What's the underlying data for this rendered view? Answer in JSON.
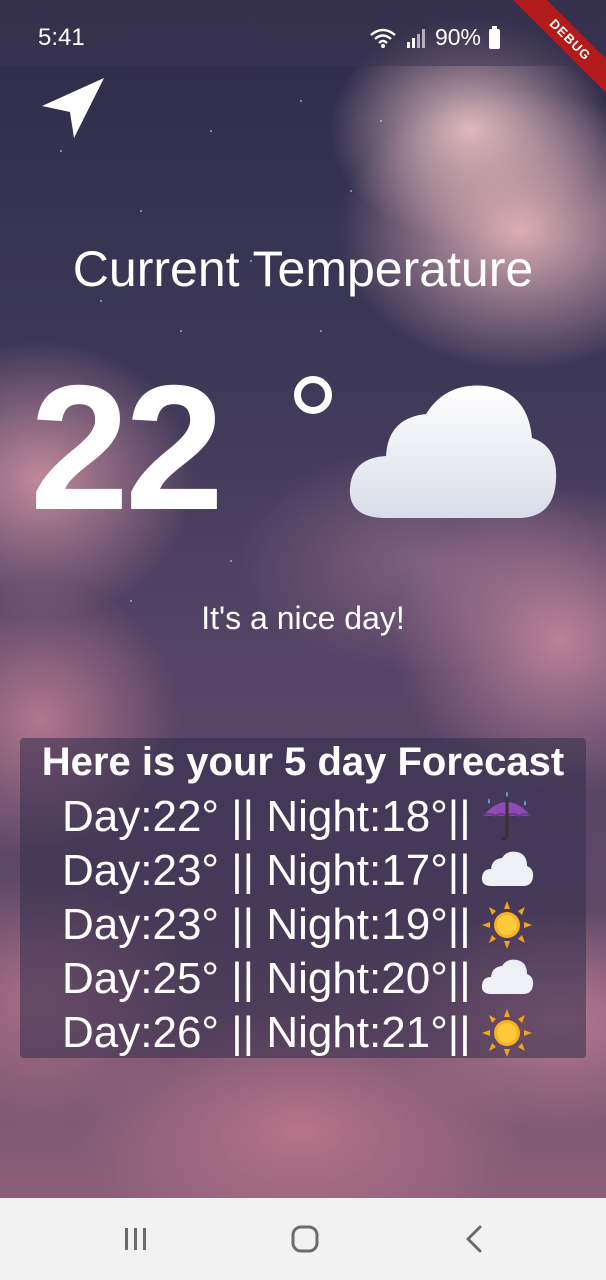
{
  "status_bar": {
    "time": "5:41",
    "battery": "90%",
    "icons": [
      "wifi-icon",
      "signal-icon",
      "battery-icon"
    ]
  },
  "debug_banner": "DEBUG",
  "location_button": {
    "icon": "navigation-arrow-icon"
  },
  "current": {
    "title": "Current Temperature",
    "temperature": "22",
    "condition_icon": "cloud-icon",
    "message": "It's a nice day!"
  },
  "forecast": {
    "heading": "Here is your 5 day Forecast",
    "days": [
      {
        "text": "Day:22° || Night:18°||",
        "icon": "umbrella-rain-icon"
      },
      {
        "text": "Day:23° || Night:17°||",
        "icon": "cloud-icon"
      },
      {
        "text": "Day:23° || Night:19°||",
        "icon": "sun-icon"
      },
      {
        "text": "Day:25° || Night:20°||",
        "icon": "cloud-icon"
      },
      {
        "text": "Day:26° || Night:21°||",
        "icon": "sun-icon"
      }
    ]
  },
  "nav_bar": {
    "icons": [
      "recent-apps-icon",
      "home-icon",
      "back-icon"
    ]
  },
  "colors": {
    "text": "#ffffff",
    "debug_banner": "#b31b1b",
    "nav_background": "#f2f2f2",
    "nav_icon": "#6b6b6b"
  }
}
